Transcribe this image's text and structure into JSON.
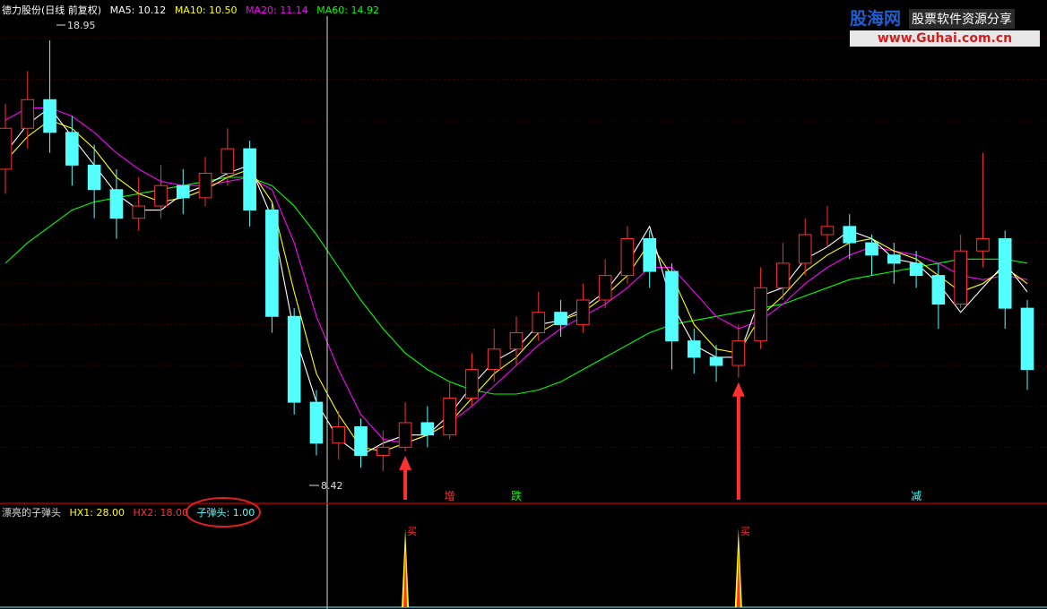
{
  "header": {
    "stock_name": "德力股份(日线 前复权)",
    "ma5": "MA5: 10.12",
    "ma10": "MA10: 10.50",
    "ma20": "MA20: 11.14",
    "ma60": "MA60: 14.92"
  },
  "indicator_header": {
    "name": "漂亮的子弹头",
    "hx1": "HX1: 28.00",
    "hx2": "HX2: 18.00",
    "zidantou": "子弹头: 1.00"
  },
  "watermark": {
    "site_name": "股海网",
    "slogan": "股票软件资源分享",
    "url": "www.Guhai.com.cn"
  },
  "colors": {
    "up": "#ff3030",
    "down": "#54ffff",
    "ma5": "#ffffff",
    "ma10": "#ffff00",
    "ma20": "#ff00ff",
    "ma60": "#00ff00",
    "axis": "#c00000",
    "signal": "#ff3030"
  },
  "chart_data": {
    "type": "candlestick",
    "price_range": [
      8.0,
      19.5
    ],
    "high_label": "18.95",
    "low_label": "8.42",
    "ma5": [
      16.2,
      16.9,
      17.3,
      16.6,
      15.9,
      15.2,
      14.8,
      14.8,
      15.2,
      15.4,
      15.7,
      15.9,
      14.6,
      11.8,
      10.1,
      9.2,
      8.8,
      9.1,
      9.3,
      9.3,
      9.8,
      10.5,
      11.1,
      11.4,
      12.0,
      12.1,
      12.4,
      12.8,
      13.5,
      14.4,
      12.5,
      11.5,
      11.2,
      11.2,
      12.7,
      12.9,
      13.6,
      13.9,
      14.3,
      14.1,
      13.6,
      13.5,
      13.0,
      12.3,
      12.9,
      13.5,
      12.8
    ],
    "ma10": [
      16.0,
      16.6,
      17.0,
      16.8,
      16.3,
      15.6,
      15.2,
      15.0,
      15.1,
      15.3,
      15.6,
      15.8,
      15.0,
      12.8,
      10.8,
      9.8,
      9.0,
      8.9,
      9.1,
      9.3,
      9.6,
      10.2,
      10.8,
      11.2,
      11.8,
      12.1,
      12.3,
      12.7,
      13.2,
      14.0,
      13.2,
      12.0,
      11.4,
      11.3,
      12.2,
      12.7,
      13.3,
      13.7,
      14.0,
      14.1,
      13.8,
      13.6,
      13.2,
      12.8,
      13.0,
      13.4,
      13.0
    ],
    "ma20": [
      17.0,
      17.3,
      17.3,
      17.1,
      16.7,
      16.2,
      15.8,
      15.5,
      15.4,
      15.4,
      15.5,
      15.6,
      15.3,
      14.0,
      12.2,
      10.9,
      9.8,
      9.2,
      9.1,
      9.3,
      9.6,
      10.0,
      10.5,
      11.0,
      11.5,
      11.9,
      12.2,
      12.5,
      12.9,
      13.4,
      13.4,
      12.8,
      12.2,
      11.9,
      12.1,
      12.5,
      13.0,
      13.4,
      13.7,
      13.9,
      13.8,
      13.7,
      13.5,
      13.2,
      13.1,
      13.2,
      13.1
    ],
    "ma60": [
      13.5,
      14.0,
      14.4,
      14.8,
      15.0,
      15.1,
      15.2,
      15.3,
      15.4,
      15.5,
      15.6,
      15.6,
      15.4,
      14.9,
      14.2,
      13.4,
      12.6,
      11.9,
      11.3,
      10.9,
      10.6,
      10.4,
      10.3,
      10.3,
      10.4,
      10.6,
      10.9,
      11.2,
      11.5,
      11.8,
      12.0,
      12.1,
      12.2,
      12.3,
      12.4,
      12.5,
      12.7,
      12.9,
      13.1,
      13.2,
      13.3,
      13.4,
      13.5,
      13.6,
      13.6,
      13.6,
      13.5
    ],
    "candles": [
      {
        "o": 15.8,
        "c": 16.8,
        "h": 17.4,
        "l": 15.2
      },
      {
        "o": 16.8,
        "c": 17.5,
        "h": 18.2,
        "l": 16.3
      },
      {
        "o": 17.5,
        "c": 16.7,
        "h": 18.95,
        "l": 16.2
      },
      {
        "o": 16.7,
        "c": 15.9,
        "h": 17.1,
        "l": 15.4
      },
      {
        "o": 15.9,
        "c": 15.3,
        "h": 16.4,
        "l": 14.6
      },
      {
        "o": 15.3,
        "c": 14.6,
        "h": 15.8,
        "l": 14.1
      },
      {
        "o": 14.6,
        "c": 14.9,
        "h": 15.6,
        "l": 14.3
      },
      {
        "o": 14.9,
        "c": 15.4,
        "h": 15.9,
        "l": 14.6
      },
      {
        "o": 15.4,
        "c": 15.1,
        "h": 15.8,
        "l": 14.7
      },
      {
        "o": 15.1,
        "c": 15.7,
        "h": 16.1,
        "l": 14.9
      },
      {
        "o": 15.7,
        "c": 16.3,
        "h": 16.8,
        "l": 15.4
      },
      {
        "o": 16.3,
        "c": 14.8,
        "h": 16.5,
        "l": 14.4
      },
      {
        "o": 14.8,
        "c": 12.2,
        "h": 15.0,
        "l": 11.8
      },
      {
        "o": 12.2,
        "c": 10.1,
        "h": 12.4,
        "l": 9.8
      },
      {
        "o": 10.1,
        "c": 9.1,
        "h": 10.4,
        "l": 8.8
      },
      {
        "o": 9.1,
        "c": 9.5,
        "h": 9.9,
        "l": 8.7
      },
      {
        "o": 9.5,
        "c": 8.8,
        "h": 9.7,
        "l": 8.5
      },
      {
        "o": 8.8,
        "c": 9.0,
        "h": 9.4,
        "l": 8.42
      },
      {
        "o": 9.0,
        "c": 9.6,
        "h": 10.1,
        "l": 8.9
      },
      {
        "o": 9.6,
        "c": 9.3,
        "h": 10.0,
        "l": 9.0
      },
      {
        "o": 9.3,
        "c": 10.2,
        "h": 10.6,
        "l": 9.2
      },
      {
        "o": 10.2,
        "c": 10.9,
        "h": 11.3,
        "l": 10.0
      },
      {
        "o": 10.9,
        "c": 11.4,
        "h": 11.9,
        "l": 10.6
      },
      {
        "o": 11.4,
        "c": 11.8,
        "h": 12.2,
        "l": 11.0
      },
      {
        "o": 11.8,
        "c": 12.3,
        "h": 12.8,
        "l": 11.6
      },
      {
        "o": 12.3,
        "c": 12.0,
        "h": 12.6,
        "l": 11.7
      },
      {
        "o": 12.0,
        "c": 12.6,
        "h": 13.0,
        "l": 11.8
      },
      {
        "o": 12.6,
        "c": 13.2,
        "h": 13.6,
        "l": 12.4
      },
      {
        "o": 13.2,
        "c": 14.1,
        "h": 14.4,
        "l": 13.0
      },
      {
        "o": 14.1,
        "c": 13.3,
        "h": 14.3,
        "l": 12.9
      },
      {
        "o": 13.3,
        "c": 11.6,
        "h": 13.5,
        "l": 10.9
      },
      {
        "o": 11.6,
        "c": 11.2,
        "h": 11.9,
        "l": 10.8
      },
      {
        "o": 11.2,
        "c": 11.0,
        "h": 11.5,
        "l": 10.6
      },
      {
        "o": 11.0,
        "c": 11.6,
        "h": 12.0,
        "l": 10.7
      },
      {
        "o": 11.6,
        "c": 12.9,
        "h": 13.4,
        "l": 11.4
      },
      {
        "o": 12.9,
        "c": 13.5,
        "h": 14.0,
        "l": 12.6
      },
      {
        "o": 13.5,
        "c": 14.2,
        "h": 14.6,
        "l": 13.2
      },
      {
        "o": 14.2,
        "c": 14.4,
        "h": 14.9,
        "l": 13.9
      },
      {
        "o": 14.4,
        "c": 14.0,
        "h": 14.7,
        "l": 13.6
      },
      {
        "o": 14.0,
        "c": 13.7,
        "h": 14.2,
        "l": 13.2
      },
      {
        "o": 13.7,
        "c": 13.5,
        "h": 14.0,
        "l": 13.0
      },
      {
        "o": 13.5,
        "c": 13.2,
        "h": 13.8,
        "l": 12.9
      },
      {
        "o": 13.2,
        "c": 12.5,
        "h": 13.5,
        "l": 11.9
      },
      {
        "o": 12.5,
        "c": 13.8,
        "h": 14.2,
        "l": 12.4
      },
      {
        "o": 13.8,
        "c": 14.1,
        "h": 16.2,
        "l": 13.4
      },
      {
        "o": 14.1,
        "c": 12.4,
        "h": 14.3,
        "l": 11.9
      },
      {
        "o": 12.4,
        "c": 10.9,
        "h": 12.6,
        "l": 10.4
      }
    ],
    "markers": [
      {
        "index": 20,
        "label": "增"
      },
      {
        "index": 23,
        "label": "跌"
      },
      {
        "index": 41,
        "label": "减"
      }
    ],
    "buy_signals": [
      {
        "index": 18,
        "label": "买"
      },
      {
        "index": 33,
        "label": "买"
      }
    ]
  }
}
